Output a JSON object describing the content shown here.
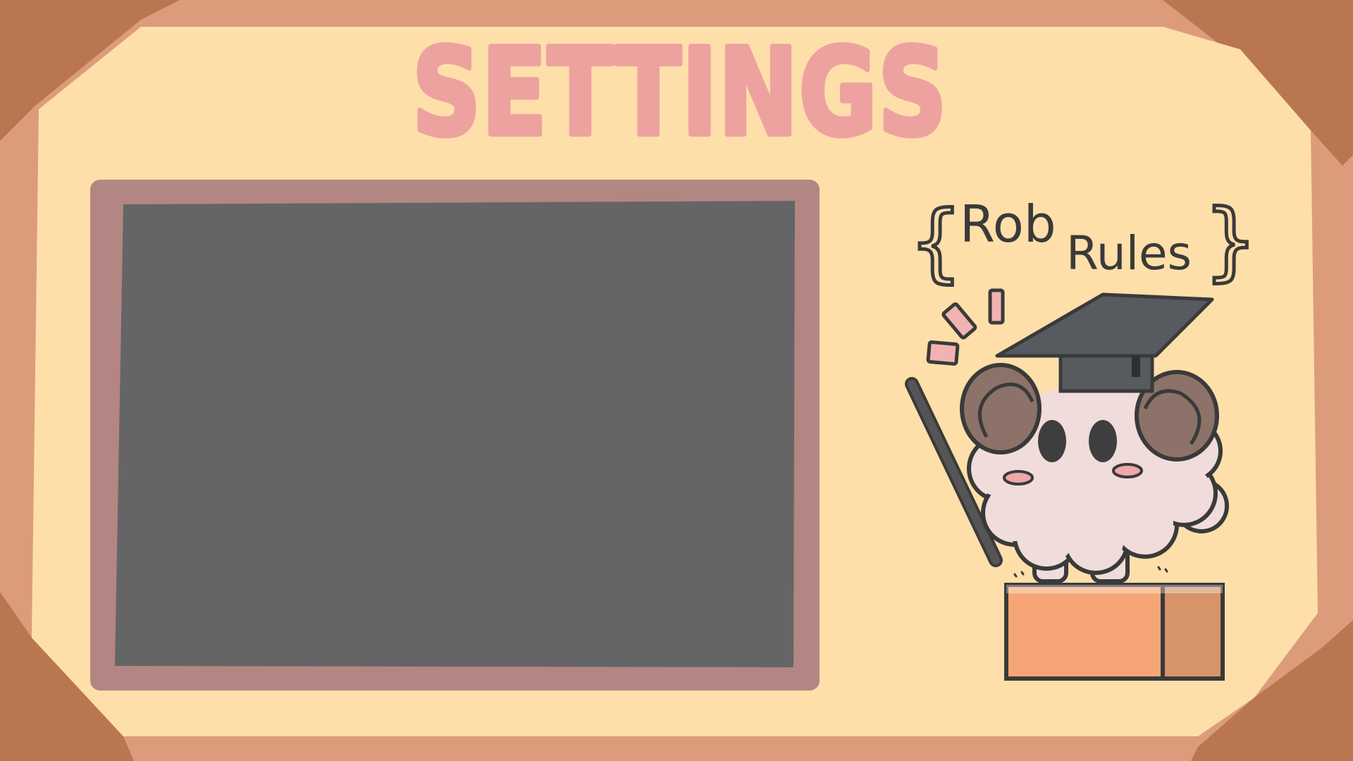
{
  "screen": {
    "title": "SETTINGS",
    "panel_state": "empty"
  },
  "banner": {
    "word1": "Rob",
    "word2": "Rules",
    "open_brace": "{",
    "close_brace": "}"
  },
  "colors": {
    "frame_outer": "#dc9c7c",
    "frame_corner": "#b97651",
    "paper": "#ffdfa9",
    "title_pink": "#eda2a0",
    "board_border": "#b38683",
    "board_surface": "#656565",
    "ink": "#3a3a3a",
    "cap_dark": "#575a5e",
    "sheep_wool": "#f0dcda",
    "sheep_horn": "#8c7268",
    "sheep_blush": "#f0a7a8",
    "block_front": "#f6a676",
    "block_side": "#d7946a",
    "sparkle_pink": "#f1b3b1"
  },
  "mascot": {
    "description_icon": "graduate-sheep-icon",
    "pointer_icon": "pointer-stick-icon",
    "cap_icon": "graduation-cap-icon",
    "pedestal_icon": "orange-block-icon",
    "sparkle_icon": "sparkle-icon"
  }
}
